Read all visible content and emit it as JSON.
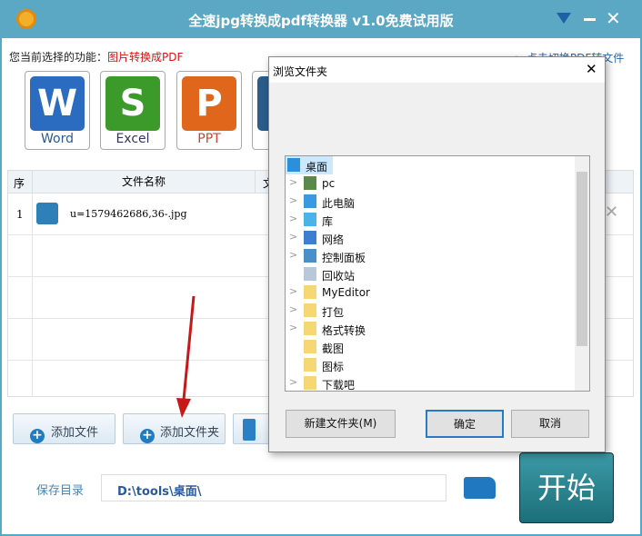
{
  "window": {
    "title": "全速jpg转换成pdf转换器 v1.0免费试用版"
  },
  "function_bar": {
    "label": "您当前选择的功能：",
    "current": "图片转换成PDF",
    "switch_link": "点击切换PDF转文件"
  },
  "function_icons": [
    {
      "label": "Word",
      "letter": "W",
      "color": "#2b6bc0"
    },
    {
      "label": "Excel",
      "letter": "S",
      "color": "#3c9a2a"
    },
    {
      "label": "PPT",
      "letter": "P",
      "color": "#e0661b"
    },
    {
      "label": "",
      "letter": "",
      "color": "#2a5d8a"
    }
  ],
  "table": {
    "headers": [
      "序",
      "文件名称",
      "文"
    ],
    "rows": [
      {
        "index": "1",
        "name": "u=1579462686,36-.jpg"
      }
    ]
  },
  "buttons": {
    "add_file": "添加文件",
    "add_folder": "添加文件夹"
  },
  "save": {
    "label": "保存目录",
    "path": "D:\\tools\\桌面\\"
  },
  "start": "开始",
  "dialog": {
    "title": "浏览文件夹",
    "tree": [
      {
        "label": "桌面",
        "icon": "desktop-icon",
        "expand": false,
        "selected": true
      },
      {
        "label": "pc",
        "icon": "user-icon",
        "expand": true
      },
      {
        "label": "此电脑",
        "icon": "computer-icon",
        "expand": true
      },
      {
        "label": "库",
        "icon": "library-icon",
        "expand": true
      },
      {
        "label": "网络",
        "icon": "network-icon",
        "expand": true
      },
      {
        "label": "控制面板",
        "icon": "control-panel-icon",
        "expand": true
      },
      {
        "label": "回收站",
        "icon": "recycle-bin-icon",
        "expand": false
      },
      {
        "label": "MyEditor",
        "icon": "folder-icon",
        "expand": true
      },
      {
        "label": "打包",
        "icon": "folder-icon",
        "expand": true
      },
      {
        "label": "格式转换",
        "icon": "folder-icon",
        "expand": true
      },
      {
        "label": "截图",
        "icon": "folder-icon",
        "expand": false
      },
      {
        "label": "图标",
        "icon": "folder-icon",
        "expand": false
      },
      {
        "label": "下载吧",
        "icon": "folder-icon",
        "expand": true
      }
    ],
    "new_folder": "新建文件夹(M)",
    "ok": "确定",
    "cancel": "取消"
  }
}
